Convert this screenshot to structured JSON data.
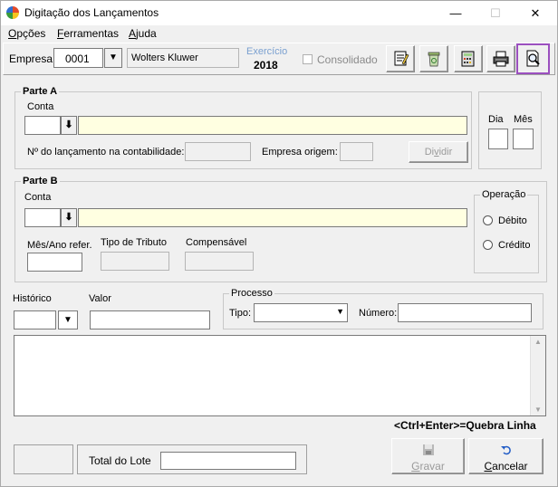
{
  "window": {
    "title": "Digitação dos Lançamentos"
  },
  "menu": [
    {
      "pre": "",
      "u": "O",
      "post": "pções"
    },
    {
      "pre": "",
      "u": "F",
      "post": "erramentas"
    },
    {
      "pre": "",
      "u": "A",
      "post": "juda"
    }
  ],
  "toolbar": {
    "empresa_label": "Empresa:",
    "empresa_code": "0001",
    "empresa_name": "Wolters Kluwer",
    "exercicio_label": "Exercício",
    "exercicio_year": "2018",
    "consolidado_label": "Consolidado"
  },
  "parteA": {
    "legend": "Parte A",
    "conta_label": "Conta",
    "conta_code": "",
    "conta_desc": "",
    "nro_label": "Nº do lançamento na contabilidade:",
    "nro_value": "",
    "empresa_origem_label": "Empresa origem:",
    "empresa_origem_value": "",
    "dividir_label": "Dividir",
    "dividir_underline": "v"
  },
  "date": {
    "dia_label": "Dia",
    "mes_label": "Mês",
    "dia_value": "",
    "mes_value": ""
  },
  "parteB": {
    "legend": "Parte B",
    "conta_label": "Conta",
    "mesano_label": "Mês/Ano refer.",
    "tipo_tributo_label": "Tipo de Tributo",
    "compensavel_label": "Compensável"
  },
  "operacao": {
    "legend": "Operação",
    "debito": "Débito",
    "credito": "Crédito"
  },
  "historico_label": "Histórico",
  "valor_label": "Valor",
  "processo": {
    "legend": "Processo",
    "tipo_label": "Tipo:",
    "numero_label": "Número:"
  },
  "hint": "<Ctrl+Enter>=Quebra Linha",
  "total_lote_label": "Total do Lote",
  "buttons": {
    "gravar": {
      "pre": "",
      "u": "G",
      "post": "ravar"
    },
    "cancelar": {
      "pre": "",
      "u": "C",
      "post": "ancelar"
    }
  }
}
